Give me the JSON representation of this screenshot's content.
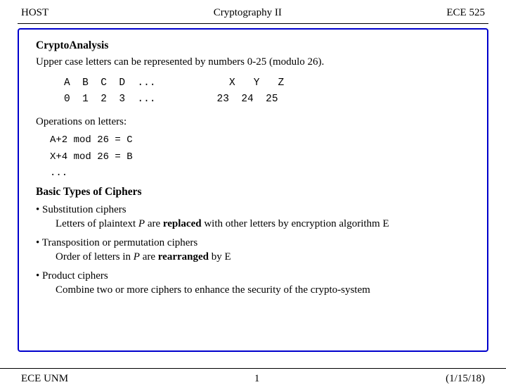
{
  "header": {
    "left": "HOST",
    "center": "Cryptography II",
    "right": "ECE 525"
  },
  "footer": {
    "left": "ECE UNM",
    "center": "1",
    "right": "(1/15/18)"
  },
  "content": {
    "section1_title": "CryptoAnalysis",
    "intro": "Upper case letters can be represented by numbers 0-25 (modulo 26).",
    "letter_row1": "A  B  C  D  ...            X   Y   Z",
    "number_row1": "0  1  2  3  ...           23  24  25",
    "ops_label": "Operations on letters:",
    "op1": "A+2 mod 26 = C",
    "op2": "X+4 mod 26 = B",
    "ellipsis": "...",
    "section2_title": "Basic Types of Ciphers",
    "cipher1_bullet": "• Substitution ciphers",
    "cipher1_desc_part1": "Letters of plaintext ",
    "cipher1_desc_italic": "P",
    "cipher1_desc_part2": " are ",
    "cipher1_desc_bold": "replaced",
    "cipher1_desc_part3": " with other letters by encryption algorithm E",
    "cipher2_bullet": "• Transposition or permutation ciphers",
    "cipher2_desc_part1": "Order of letters in ",
    "cipher2_desc_italic": "P",
    "cipher2_desc_part2": " are ",
    "cipher2_desc_bold": "rearranged",
    "cipher2_desc_part3": " by E",
    "cipher3_bullet": "• Product ciphers",
    "cipher3_desc": "Combine two or more ciphers to enhance the security of the crypto-system"
  }
}
